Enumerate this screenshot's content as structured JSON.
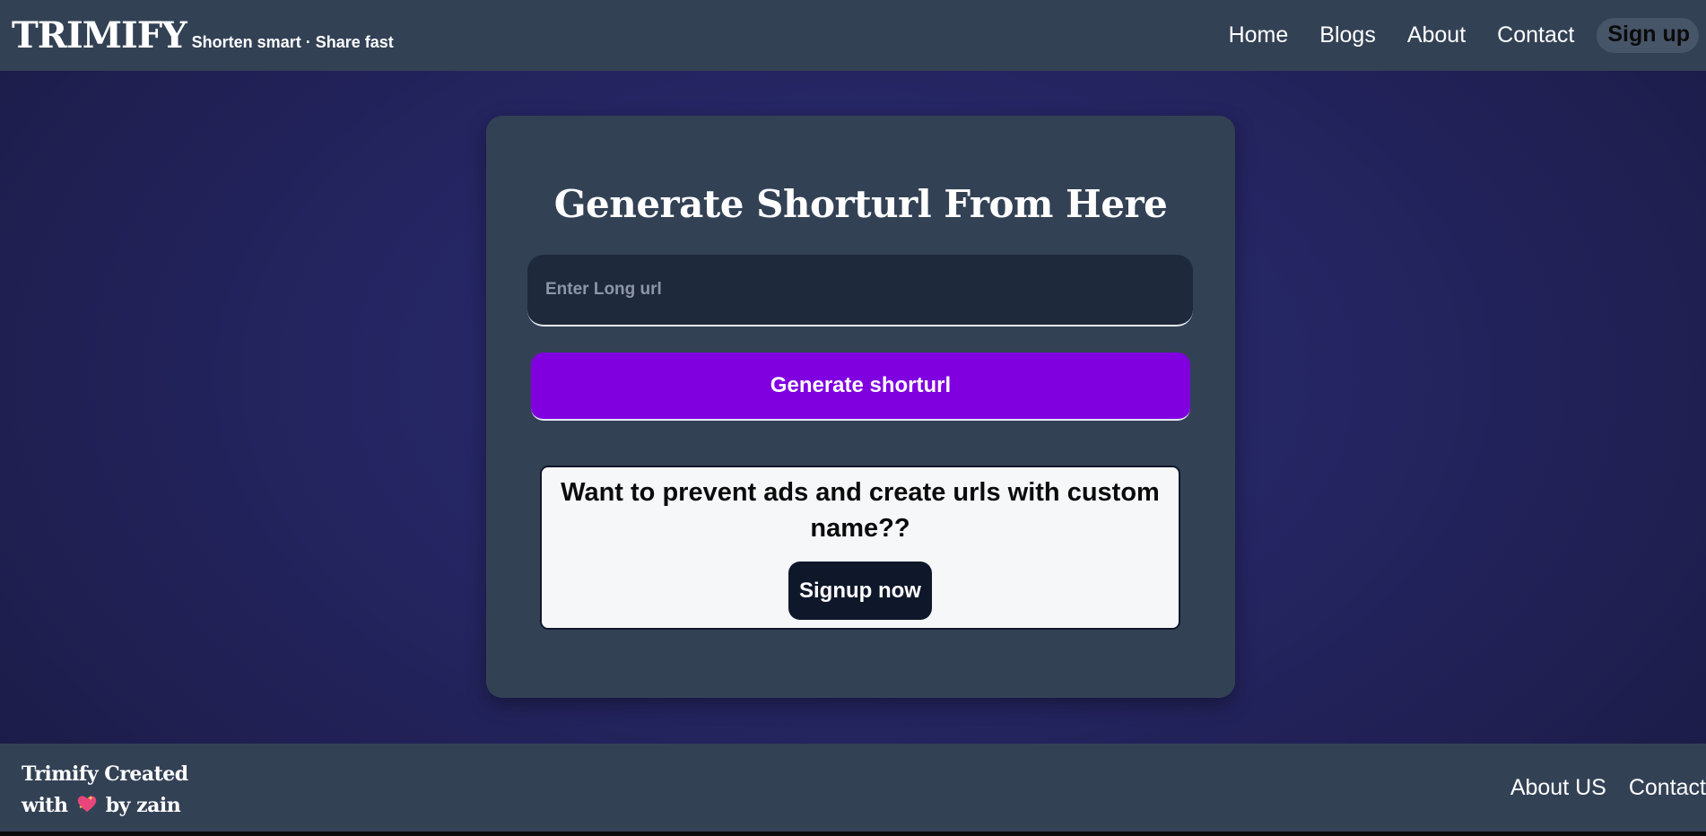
{
  "header": {
    "brand": "TRIMIFY",
    "tagline": "Shorten smart · Share fast",
    "nav": [
      "Home",
      "Blogs",
      "About",
      "Contact"
    ],
    "signup_label": "Sign up"
  },
  "main": {
    "heading": "Generate Shorturl From Here",
    "input_placeholder": "Enter Long url",
    "input_value": "",
    "generate_label": "Generate shorturl",
    "promo_text": "Want to prevent ads and create urls with custom name??",
    "promo_button": "Signup now"
  },
  "footer": {
    "credit_line1": "Trimify Created",
    "credit_with": "with",
    "credit_by": "by zain",
    "links": [
      "About US",
      "Contact"
    ]
  },
  "colors": {
    "accent": "#8000e0",
    "surface": "#334155",
    "input_bg": "#1e293b",
    "dark_button": "#0f172a",
    "heart": "#e8467a"
  }
}
